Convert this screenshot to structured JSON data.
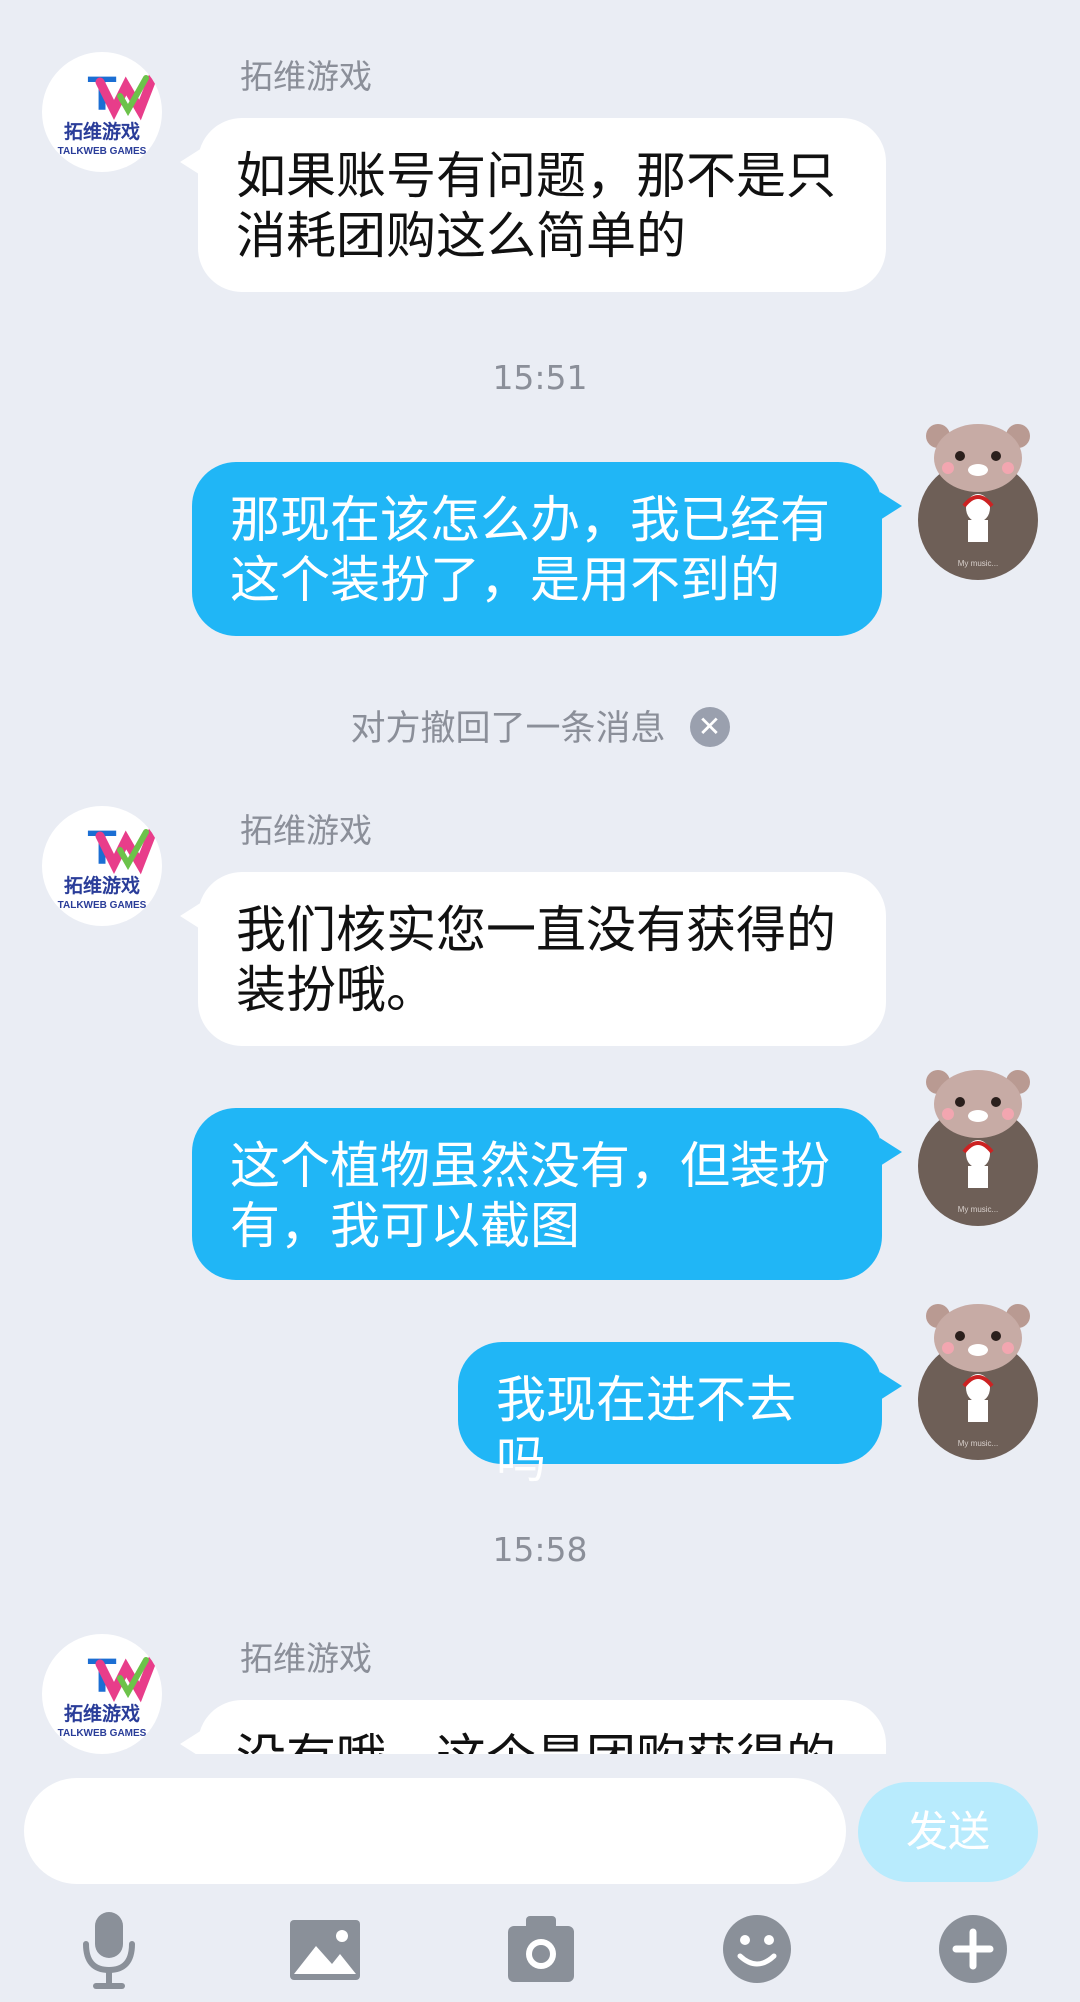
{
  "messages": [
    {
      "sender": "拓维游戏",
      "text_line1": "如果账号有问题，那不是只",
      "text_line2": "消耗团购这么简单的"
    },
    {
      "timestamp": "15:51"
    },
    {
      "outgoing_line1": "那现在该怎么办，我已经有",
      "outgoing_line2": "这个装扮了，是用不到的"
    },
    {
      "recall_notice": "对方撤回了一条消息"
    },
    {
      "sender": "拓维游戏",
      "text_line1": "我们核实您一直没有获得的",
      "text_line2": "装扮哦。"
    },
    {
      "outgoing_line1": "这个植物虽然没有，但装扮",
      "outgoing_line2": "有，我可以截图"
    },
    {
      "outgoing_line1": "我现在进不去吗"
    },
    {
      "timestamp": "15:58"
    },
    {
      "sender": "拓维游戏",
      "text_line1": "没有哦，这个是团购获得的"
    }
  ],
  "avatar": {
    "logo_text": "拓维游戏",
    "logo_sub": "TALKWEB GAMES",
    "user_caption": "My music..."
  },
  "input": {
    "placeholder": "",
    "send_label": "发送"
  },
  "toolbar": [
    "mic-icon",
    "image-icon",
    "camera-icon",
    "emoji-icon",
    "plus-icon"
  ],
  "colors": {
    "background": "#eaedf4",
    "outgoing_bubble": "#20b6f6",
    "incoming_bubble": "#ffffff",
    "send_button": "#b8ebfd",
    "icon": "#8a9099"
  }
}
